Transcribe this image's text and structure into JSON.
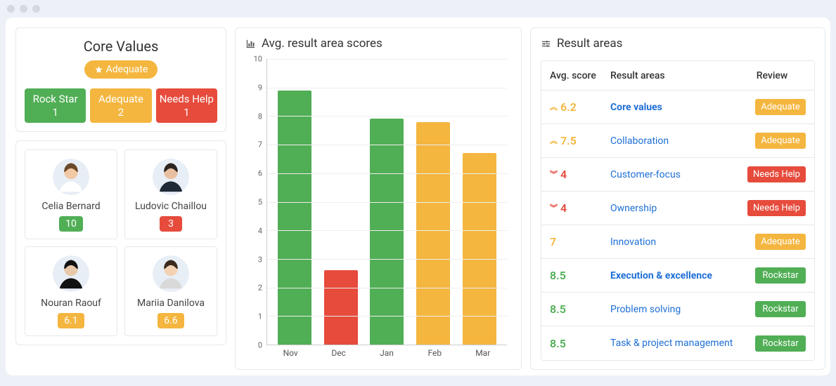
{
  "core_values": {
    "title": "Core Values",
    "badge": "Adequate",
    "boxes": [
      {
        "label": "Rock Star",
        "count": "1",
        "cls": "sb-green"
      },
      {
        "label": "Adequate",
        "count": "2",
        "cls": "sb-amber"
      },
      {
        "label": "Needs Help",
        "count": "1",
        "cls": "sb-red"
      }
    ]
  },
  "people": [
    {
      "name": "Celia Bernard",
      "score": "10",
      "score_bg": "#50ae55",
      "skin": "#f1c9a5",
      "hair": "#6b4a2b",
      "shirt": "#ffffff"
    },
    {
      "name": "Ludovic Chaillou",
      "score": "3",
      "score_bg": "#e64b3c",
      "skin": "#e8bfa0",
      "hair": "#2d2420",
      "shirt": "#1f2a36"
    },
    {
      "name": "Nouran Raouf",
      "score": "6.1",
      "score_bg": "#f4b63f",
      "skin": "#e8c8a8",
      "hair": "#121212",
      "shirt": "#111111"
    },
    {
      "name": "Mariia Danilova",
      "score": "6.6",
      "score_bg": "#f4b63f",
      "skin": "#f3d2b3",
      "hair": "#3a2a1e",
      "shirt": "#d9d9d9"
    }
  ],
  "chart_title": "Avg. result area scores",
  "chart_data": {
    "type": "bar",
    "title": "Avg. result area scores",
    "xlabel": "",
    "ylabel": "",
    "ylim": [
      0,
      10
    ],
    "yticks": [
      0,
      1,
      2,
      3,
      4,
      5,
      6,
      7,
      8,
      9,
      10
    ],
    "categories": [
      "Nov",
      "Dec",
      "Jan",
      "Feb",
      "Mar"
    ],
    "values": [
      8.9,
      2.6,
      7.9,
      7.8,
      6.7
    ],
    "colors": [
      "#50ae55",
      "#e64b3c",
      "#50ae55",
      "#f4b63f",
      "#f4b63f"
    ]
  },
  "result_areas": {
    "title": "Result areas",
    "headers": {
      "score": "Avg. score",
      "area": "Result areas",
      "review": "Review"
    },
    "rows": [
      {
        "score": "6.2",
        "trend": "up",
        "score_cls": "amber",
        "name": "Core values",
        "bold": true,
        "badge": "Adequate",
        "badge_bg": "#f4b63f"
      },
      {
        "score": "7.5",
        "trend": "up",
        "score_cls": "amber",
        "name": "Collaboration",
        "bold": false,
        "badge": "Adequate",
        "badge_bg": "#f4b63f"
      },
      {
        "score": "4",
        "trend": "down",
        "score_cls": "red",
        "name": "Customer-focus",
        "bold": false,
        "badge": "Needs Help",
        "badge_bg": "#e64b3c"
      },
      {
        "score": "4",
        "trend": "down",
        "score_cls": "red",
        "name": "Ownership",
        "bold": false,
        "badge": "Needs Help",
        "badge_bg": "#e64b3c"
      },
      {
        "score": "7",
        "trend": "",
        "score_cls": "amber",
        "name": "Innovation",
        "bold": false,
        "badge": "Adequate",
        "badge_bg": "#f4b63f"
      },
      {
        "score": "8.5",
        "trend": "",
        "score_cls": "green",
        "name": "Execution & excellence",
        "bold": true,
        "badge": "Rockstar",
        "badge_bg": "#50ae55"
      },
      {
        "score": "8.5",
        "trend": "",
        "score_cls": "green",
        "name": "Problem solving",
        "bold": false,
        "badge": "Rockstar",
        "badge_bg": "#50ae55"
      },
      {
        "score": "8.5",
        "trend": "",
        "score_cls": "green",
        "name": "Task & project management",
        "bold": false,
        "badge": "Rockstar",
        "badge_bg": "#50ae55"
      }
    ]
  }
}
